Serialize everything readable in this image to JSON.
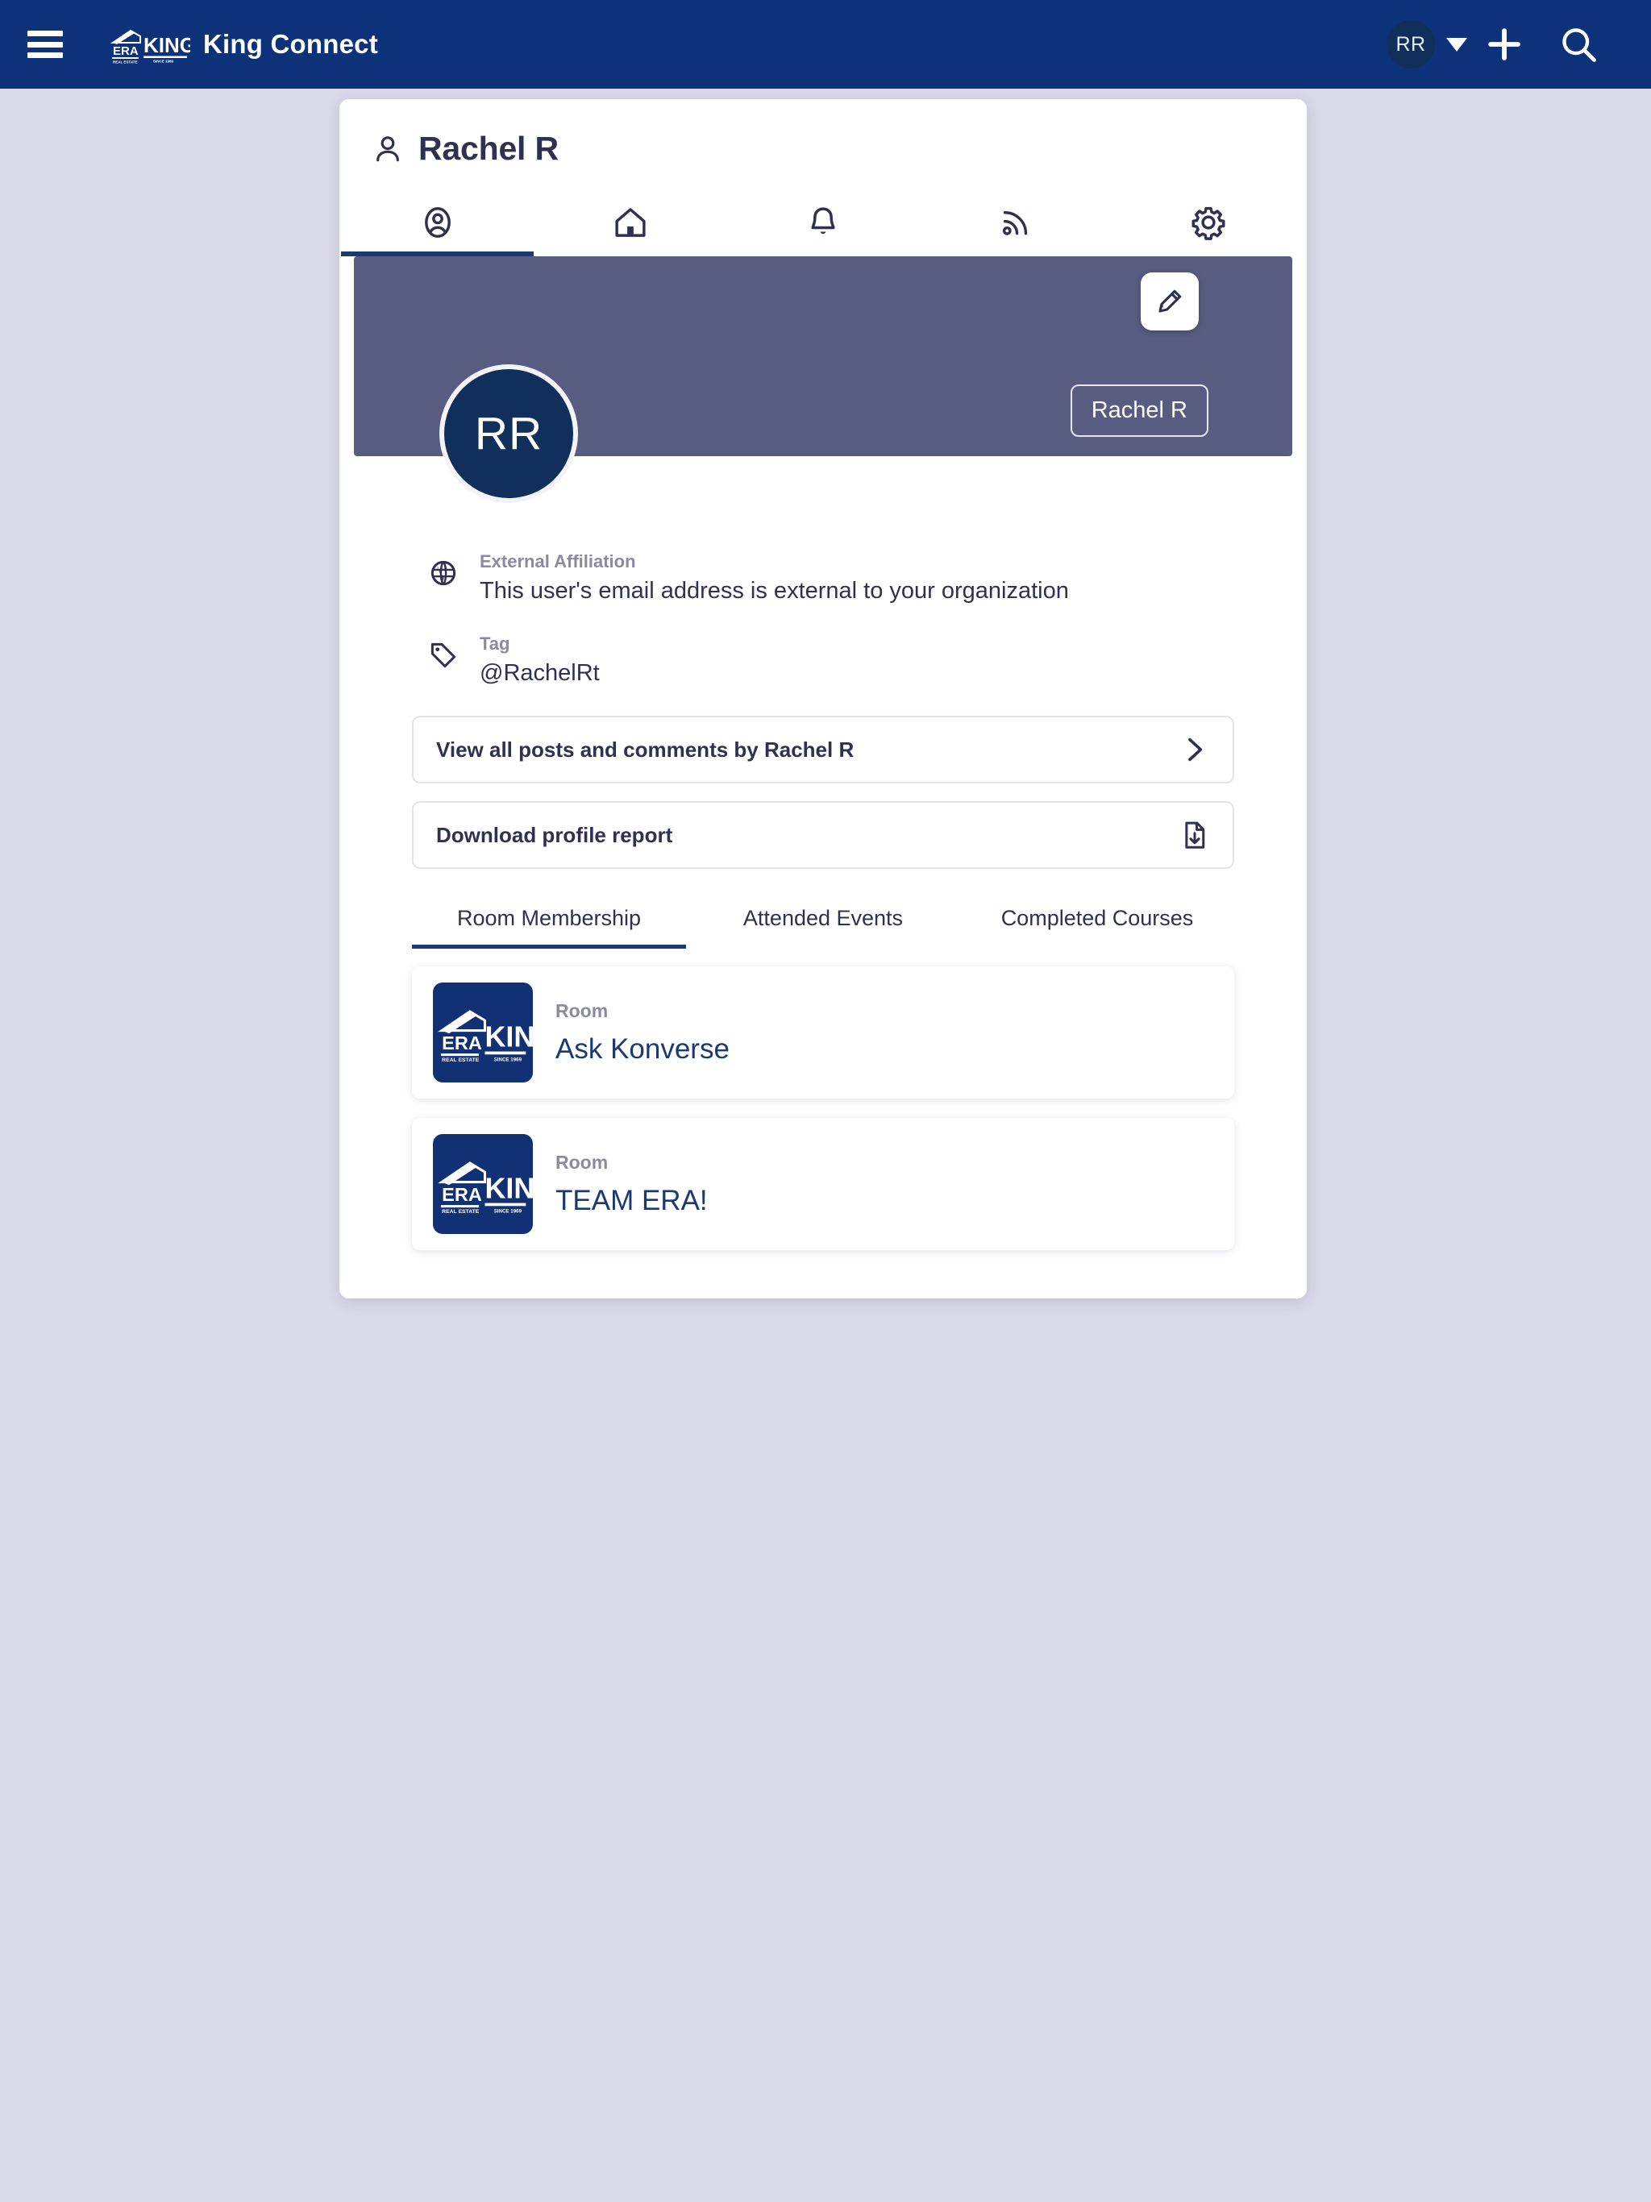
{
  "appbar": {
    "menu_icon": "hamburger-icon",
    "brand_logo": "era-king-logo",
    "title": "King Connect",
    "account_initials": "RR",
    "caret_icon": "chevron-down-icon",
    "add_icon": "plus-icon",
    "search_icon": "search-icon",
    "background_color": "#0d3279"
  },
  "profile": {
    "header_icon": "person-icon",
    "name": "Rachel R",
    "avatar_initials": "RR",
    "avatar_color": "#10305b",
    "banner_color": "#585c80",
    "edit_icon": "pencil-icon",
    "name_chip": "Rachel R",
    "icon_tabs": [
      {
        "name": "tab-profile",
        "icon": "profile-circle-icon",
        "active": true
      },
      {
        "name": "tab-home",
        "icon": "home-icon",
        "active": false
      },
      {
        "name": "tab-notifications",
        "icon": "bell-icon",
        "active": false
      },
      {
        "name": "tab-feed",
        "icon": "rss-icon",
        "active": false
      },
      {
        "name": "tab-settings",
        "icon": "gear-icon",
        "active": false
      }
    ],
    "details": [
      {
        "icon": "globe-icon",
        "label": "External Affiliation",
        "value": "This user's email address is external to your organization"
      },
      {
        "icon": "tag-icon",
        "label": "Tag",
        "value": "@RachelRt"
      }
    ],
    "actions": [
      {
        "name": "view-posts-button",
        "label": "View all posts and comments by Rachel R",
        "icon": "chevron-right-icon"
      },
      {
        "name": "download-report-button",
        "label": "Download profile report",
        "icon": "file-download-icon"
      }
    ],
    "tabs": [
      {
        "label": "Room Membership",
        "active": true
      },
      {
        "label": "Attended Events",
        "active": false
      },
      {
        "label": "Completed Courses",
        "active": false
      }
    ],
    "rooms": [
      {
        "kind": "Room",
        "name": "Ask Konverse",
        "logo": "era-king-logo"
      },
      {
        "kind": "Room",
        "name": "TEAM ERA!",
        "logo": "era-king-logo"
      }
    ]
  },
  "colors": {
    "page_background": "#d9d9e8",
    "brand_navy": "#0d3279",
    "accent_underline": "#1b3a72",
    "muted_text": "#8a8aa0",
    "body_text": "#2f3150"
  }
}
